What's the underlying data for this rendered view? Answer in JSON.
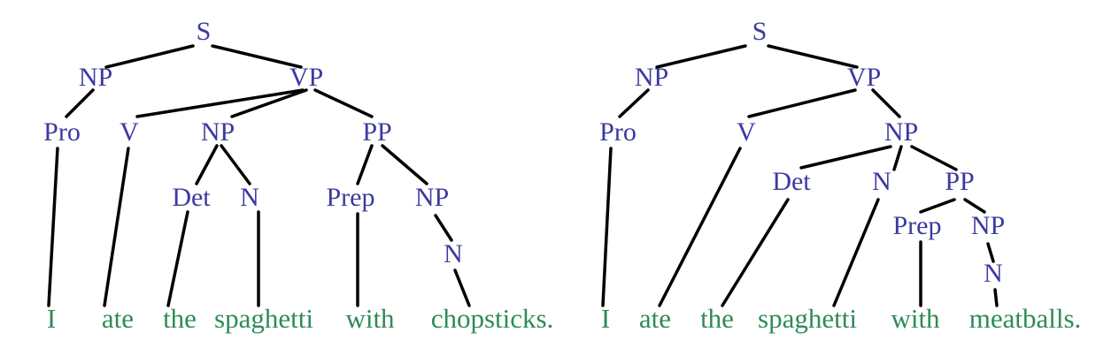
{
  "colors": {
    "nonterminal": "#3a3aa0",
    "word": "#2e8b57",
    "edge": "#000000"
  },
  "trees": [
    {
      "labels": {
        "s": "S",
        "np_subj": "NP",
        "vp": "VP",
        "pro": "Pro",
        "v": "V",
        "np_obj": "NP",
        "pp": "PP",
        "det": "Det",
        "n": "N",
        "prep": "Prep",
        "np_pp": "NP",
        "n_pp": "N"
      },
      "words": [
        "I",
        "ate",
        "the",
        "spaghetti",
        "with",
        "chopsticks."
      ]
    },
    {
      "labels": {
        "s": "S",
        "np_subj": "NP",
        "vp": "VP",
        "pro": "Pro",
        "v": "V",
        "np_obj": "NP",
        "det": "Det",
        "n": "N",
        "pp": "PP",
        "prep": "Prep",
        "np_pp": "NP",
        "n_pp": "N"
      },
      "words": [
        "I",
        "ate",
        "the",
        "spaghetti",
        "with",
        "meatballs."
      ]
    }
  ]
}
